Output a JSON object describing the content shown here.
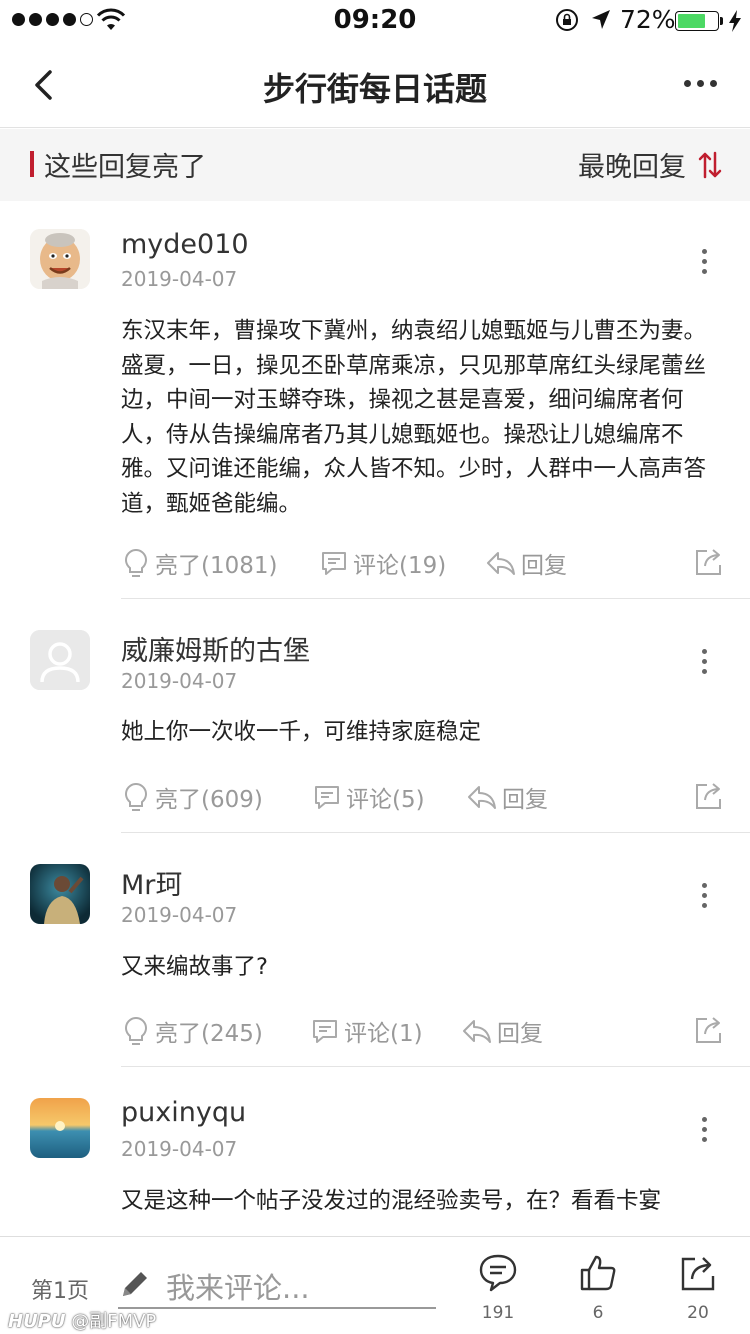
{
  "status": {
    "time": "09:20",
    "battery": "72%",
    "battery_level": 0.72
  },
  "nav": {
    "title": "步行街每日话题"
  },
  "section": {
    "title": "这些回复亮了",
    "sort_label": "最晚回复"
  },
  "comments": [
    {
      "username": "myde010",
      "date": "2019-04-07",
      "text": "东汉末年，曹操攻下冀州，纳袁绍儿媳甄姬与儿曹丕为妻。盛夏，一日，操见丕卧草席乘凉，只见那草席红头绿尾蕾丝边，中间一对玉蟒夺珠，操视之甚是喜爱，细问编席者何人，侍从告操编席者乃其儿媳甄姬也。操恐让儿媳编席不雅。又问谁还能编，众人皆不知。少时，人群中一人高声答道，甄姬爸能编。",
      "like_label": "亮了(1081)",
      "comment_label": "评论(19)",
      "reply_label": "回复"
    },
    {
      "username": "威廉姆斯的古堡",
      "date": "2019-04-07",
      "text": "她上你一次收一千，可维持家庭稳定",
      "like_label": "亮了(609)",
      "comment_label": "评论(5)",
      "reply_label": "回复"
    },
    {
      "username": "Mr珂",
      "date": "2019-04-07",
      "text": "又来编故事了?",
      "like_label": "亮了(245)",
      "comment_label": "评论(1)",
      "reply_label": "回复"
    },
    {
      "username": "puxinyqu",
      "date": "2019-04-07",
      "text": "又是这种一个帖子没发过的混经验卖号，在？看看卡宴",
      "like_label": "",
      "comment_label": "",
      "reply_label": ""
    }
  ],
  "bottom": {
    "page_label": "第1页",
    "comment_placeholder": "我来评论...",
    "comment_count": "191",
    "like_count": "6",
    "share_count": "20"
  },
  "watermark": {
    "brand": "HUPU",
    "user": "@副FMVP"
  },
  "colors": {
    "accent": "#c01e2f",
    "battery": "#4cd964",
    "muted": "#999999"
  }
}
